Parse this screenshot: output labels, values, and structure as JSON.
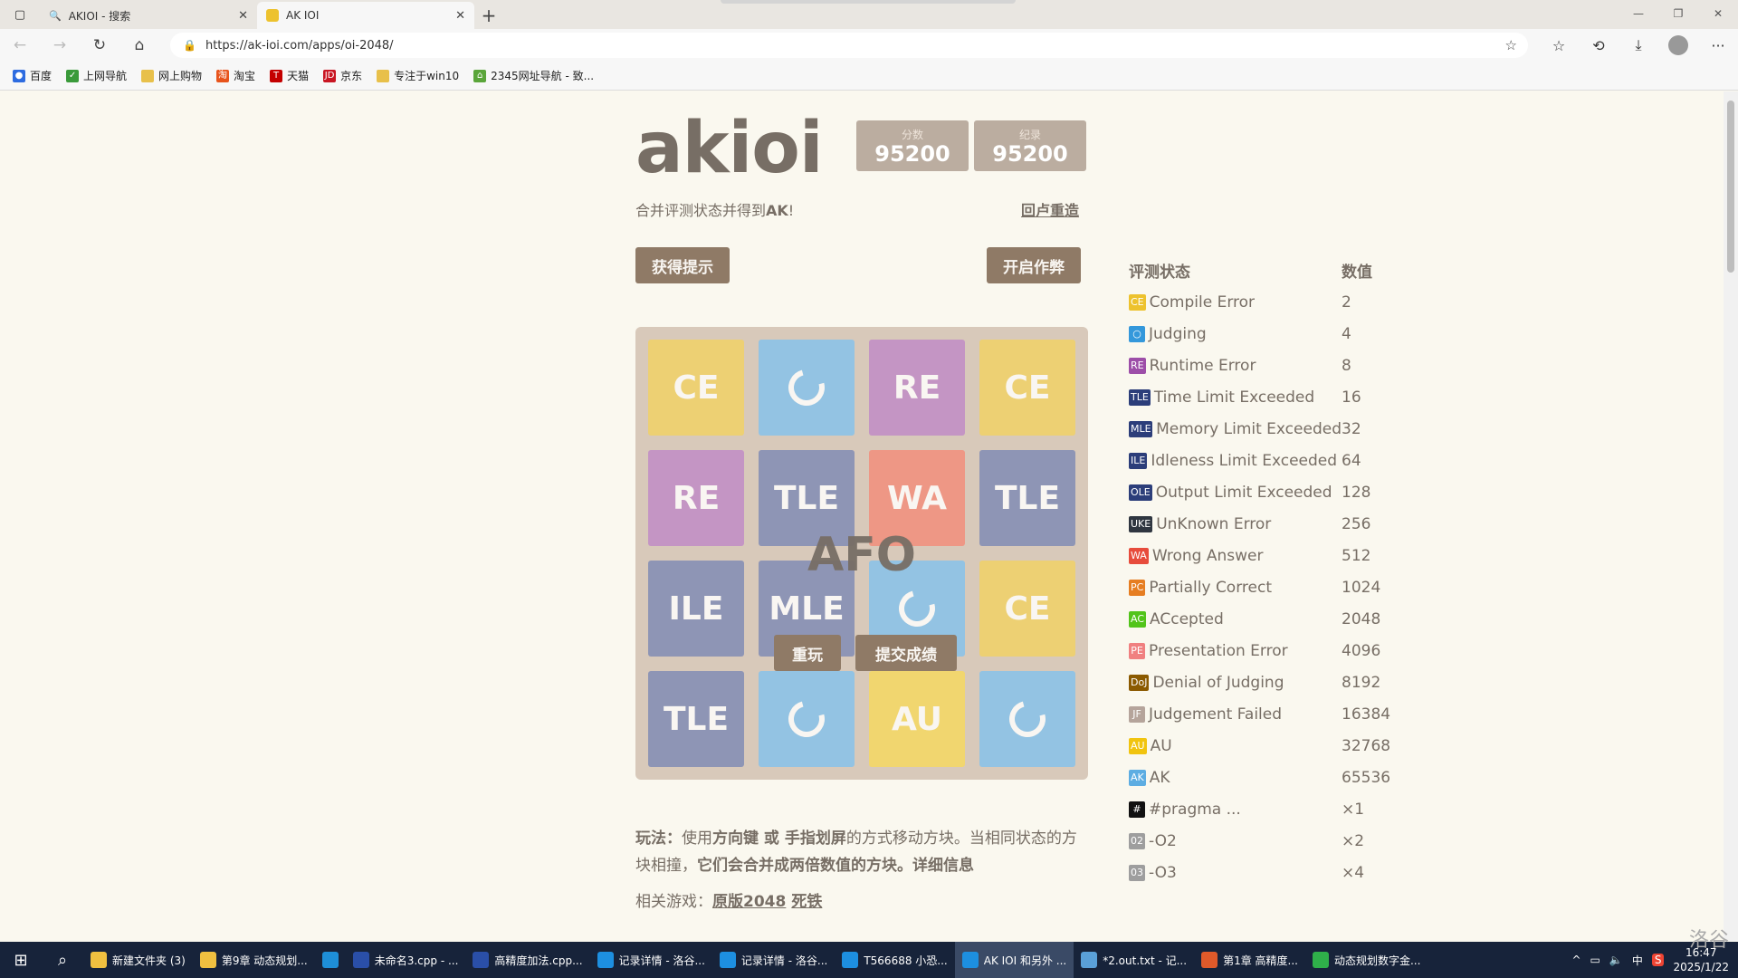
{
  "browser": {
    "tabs": [
      {
        "label": "AKIOI - 搜索",
        "active": false
      },
      {
        "label": "AK IOI",
        "active": true
      }
    ],
    "url": "https://ak-ioi.com/apps/oi-2048/",
    "bookmarks": [
      "百度",
      "上网导航",
      "网上购物",
      "淘宝",
      "天猫",
      "京东",
      "专注于win10",
      "2345网址导航 - 致..."
    ]
  },
  "game": {
    "title": "akioi",
    "score_label": "分数",
    "score": "95200",
    "best_label": "纪录",
    "best": "95200",
    "intro_prefix": "合并评测状态并得到",
    "intro_bold": "AK",
    "intro_suffix": "!",
    "restart_link": "回卢重造",
    "hint_button": "获得提示",
    "cheat_button": "开启作弊",
    "overlay_message": "AFO",
    "retry_button": "重玩",
    "submit_button": "提交成绩",
    "board": [
      [
        "CE",
        "ring",
        "RE",
        "CE"
      ],
      [
        "RE",
        "TLE",
        "WA",
        "TLE"
      ],
      [
        "ILE",
        "MLE",
        "ring",
        "CE"
      ],
      [
        "TLE",
        "ring",
        "AU",
        "ring"
      ]
    ],
    "howto": {
      "label": "玩法：",
      "t1": "使用",
      "b1": "方向键 或 手指划屏",
      "t2": "的方式移动方块。当相同状态的方块相撞，",
      "b2": "它们会合并成两倍数值的方块。",
      "link": "详细信息"
    },
    "related_label": "相关游戏：",
    "related_links": [
      "原版2048",
      "死铁"
    ]
  },
  "legend": {
    "header_status": "评测状态",
    "header_value": "数值",
    "rows": [
      {
        "badge": "CE",
        "color": "#edc22e",
        "name": "Compile Error",
        "value": "2"
      },
      {
        "badge": "○",
        "color": "#3498db",
        "name": "Judging",
        "value": "4"
      },
      {
        "badge": "RE",
        "color": "#9d4ea8",
        "name": "Runtime Error",
        "value": "8"
      },
      {
        "badge": "TLE",
        "color": "#2c3e7a",
        "name": "Time Limit Exceeded",
        "value": "16"
      },
      {
        "badge": "MLE",
        "color": "#2c3e7a",
        "name": "Memory Limit Exceeded",
        "value": "32"
      },
      {
        "badge": "ILE",
        "color": "#2c3e7a",
        "name": "Idleness Limit Exceeded",
        "value": "64"
      },
      {
        "badge": "OLE",
        "color": "#2c3e7a",
        "name": "Output Limit Exceeded",
        "value": "128"
      },
      {
        "badge": "UKE",
        "color": "#2f3640",
        "name": "UnKnown Error",
        "value": "256"
      },
      {
        "badge": "WA",
        "color": "#e74c3c",
        "name": "Wrong Answer",
        "value": "512"
      },
      {
        "badge": "PC",
        "color": "#e67e22",
        "name": "Partially Correct",
        "value": "1024"
      },
      {
        "badge": "AC",
        "color": "#52c41a",
        "name": "ACcepted",
        "value": "2048"
      },
      {
        "badge": "PE",
        "color": "#f08080",
        "name": "Presentation Error",
        "value": "4096"
      },
      {
        "badge": "DoJ",
        "color": "#8b5a00",
        "name": "Denial of Judging",
        "value": "8192"
      },
      {
        "badge": "JF",
        "color": "#b5a49b",
        "name": "Judgement Failed",
        "value": "16384"
      },
      {
        "badge": "AU",
        "color": "#f1c40f",
        "name": "AU",
        "value": "32768"
      },
      {
        "badge": "AK",
        "color": "#5dade2",
        "name": "AK",
        "value": "65536"
      },
      {
        "badge": "#",
        "color": "#111111",
        "name": "#pragma ...",
        "value": "×1"
      },
      {
        "badge": "02",
        "color": "#9e9e9e",
        "name": "-O2",
        "value": "×2"
      },
      {
        "badge": "03",
        "color": "#9e9e9e",
        "name": "-O3",
        "value": "×4"
      }
    ]
  },
  "tile_colors": {
    "CE": "#edd073",
    "ring": "#93c3e3",
    "RE": "#c495c4",
    "TLE": "#8e95b5",
    "WA": "#ee9785",
    "ILE": "#8e95b5",
    "MLE": "#8e95b5",
    "AU": "#f1d66f"
  },
  "taskbar": {
    "items": [
      "新建文件夹 (3)",
      "第9章 动态规划...",
      "",
      "未命名3.cpp - ...",
      "高精度加法.cpp...",
      "记录详情 - 洛谷...",
      "记录详情 - 洛谷...",
      "T566688 小恐...",
      "AK IOI 和另外 ...",
      "*2.out.txt - 记...",
      "第1章 高精度...",
      "动态规划数字金..."
    ],
    "time": "16:47",
    "date": "2025/1/22",
    "ime": "中",
    "watermark": "洛谷"
  }
}
